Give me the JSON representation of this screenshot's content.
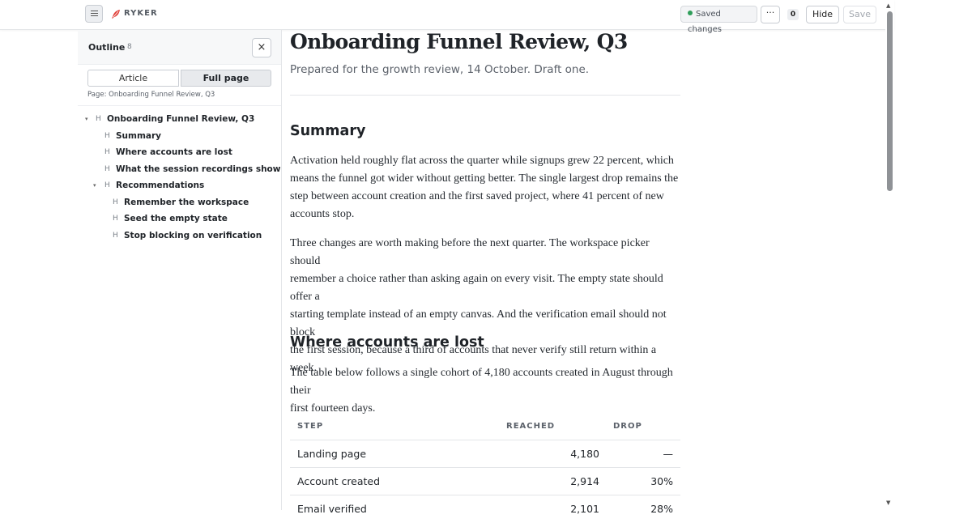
{
  "app": {
    "brand": "RYKER"
  },
  "toolbar": {
    "saved_status": "Saved changes",
    "more_label": "···",
    "count": "0",
    "hide_label": "Hide",
    "save_label": "Save"
  },
  "outline": {
    "title": "Outline",
    "count": "8",
    "close_label": "×",
    "mode_article": "Article",
    "mode_full": "Full page",
    "page_label": "Page: Onboarding Funnel Review, Q3",
    "items": [
      {
        "label": "Onboarding Funnel Review, Q3",
        "marker": "H",
        "toggle": "▾"
      },
      {
        "label": "Summary",
        "marker": "H"
      },
      {
        "label": "Where accounts are lost",
        "marker": "H"
      },
      {
        "label": "What the session recordings show",
        "marker": "H"
      },
      {
        "label": "Recommendations",
        "marker": "H",
        "toggle": "▾"
      },
      {
        "label": "Remember the workspace",
        "marker": "H"
      },
      {
        "label": "Seed the empty state",
        "marker": "H"
      },
      {
        "label": "Stop blocking on verification",
        "marker": "H"
      }
    ]
  },
  "document": {
    "title": "Onboarding Funnel Review, Q3",
    "subtitle": "Prepared for the growth review, 14 October. Draft one.",
    "summary_heading": "Summary",
    "summary_p1_lines": [
      "Activation held roughly flat across the quarter while signups grew 22 percent, which",
      "means the funnel got wider without getting better. The single largest drop remains the",
      "step between account creation and the first saved project, where 41 percent of new",
      "accounts stop."
    ],
    "summary_p2_lines": [
      "Three changes are worth making before the next quarter. The workspace picker should",
      "remember a choice rather than asking again on every visit. The empty state should offer a",
      "starting template instead of an empty canvas. And the verification email should not block",
      "the first session, because a third of accounts that never verify still return within a week."
    ],
    "lost_heading": "Where accounts are lost",
    "lost_p_lines": [
      "The table below follows a single cohort of 4,180 accounts created in August through their",
      "first fourteen days."
    ],
    "table": {
      "headers": [
        "STEP",
        "REACHED",
        "DROP"
      ],
      "rows": [
        [
          "Landing page",
          "4,180",
          "—"
        ],
        [
          "Account created",
          "2,914",
          "30%"
        ],
        [
          "Email verified",
          "2,101",
          "28%"
        ]
      ]
    }
  },
  "scrollbar": {
    "up": "▲",
    "down": "▼"
  }
}
